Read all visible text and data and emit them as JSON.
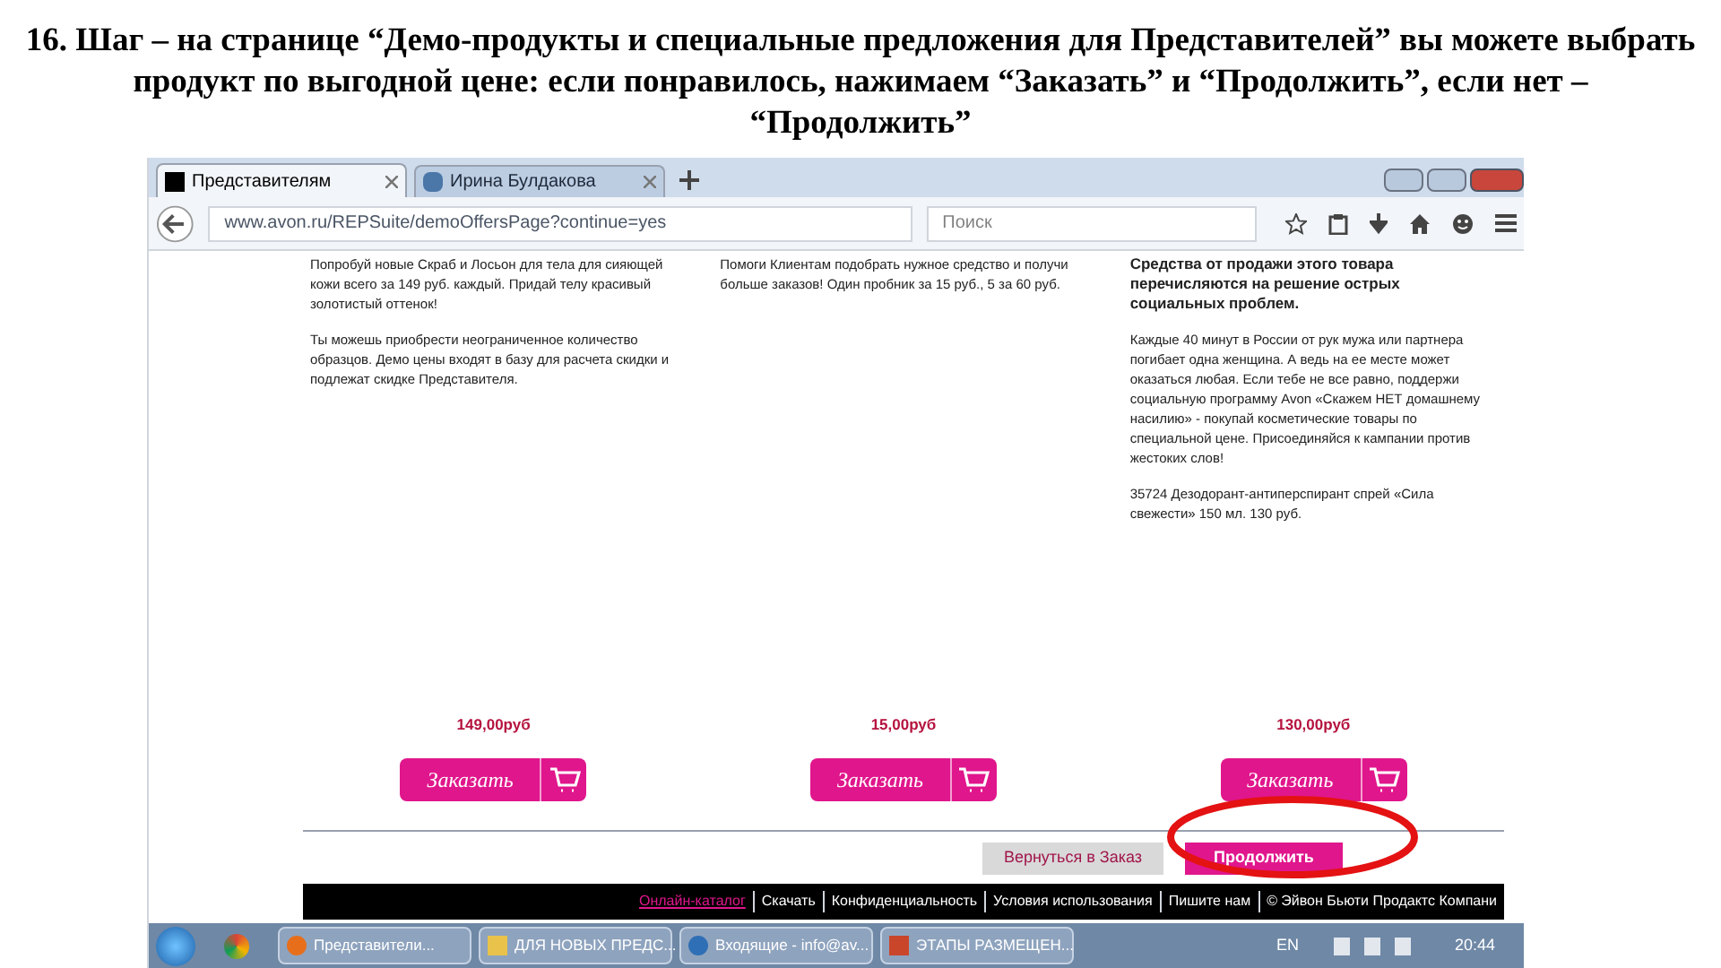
{
  "slide_title": "16. Шаг – на странице “Демо-продукты и специальные предложения для Представителей” вы можете выбрать продукт по выгодной цене: если понравилось, нажимаем “Заказать” и “Продолжить”, если нет – “Продолжить”",
  "browser": {
    "tabs": [
      {
        "label": "Представителям",
        "selected": true
      },
      {
        "label": "Ирина Булдакова",
        "selected": false
      }
    ],
    "url": "www.avon.ru/REPSuite/demoOffersPage?continue=yes",
    "search": {
      "placeholder": "Поиск"
    }
  },
  "products": [
    {
      "paragraphs": [
        {
          "text": "Попробуй новые Скраб и Лосьон для тела для сияющей кожи всего за 149 руб. каждый. Придай телу красивый золотистый оттенок!",
          "bold": false
        },
        {
          "text": "Ты можешь приобрести неограниченное количество образцов. Демо цены входят в базу для расчета скидки и подлежат скидке Представителя.",
          "bold": false
        }
      ],
      "price": "149,00руб",
      "order_button": "Заказать"
    },
    {
      "paragraphs": [
        {
          "text": "Помоги Клиентам подобрать нужное средство и получи больше заказов! Один пробник за 15 руб., 5 за 60 руб.",
          "bold": false
        }
      ],
      "price": "15,00руб",
      "order_button": "Заказать"
    },
    {
      "paragraphs": [
        {
          "text": "Средства от продажи этого товара перечисляются на решение острых социальных проблем.",
          "bold": true
        },
        {
          "text": "Каждые 40 минут в России от рук мужа или партнера погибает одна женщина. А ведь на ее месте может оказаться любая. Если тебе не все равно, поддержи социальную программу Avon «Скажем НЕТ домашнему насилию» - покупай косметические товары по специальной цене. Присоединяйся к кампании против жестоких слов!",
          "bold": false
        },
        {
          "text": "35724 Дезодорант-антиперспирант спрей «Сила свежести» 150 мл. 130 руб.",
          "bold": false
        }
      ],
      "price": "130,00руб",
      "order_button": "Заказать"
    }
  ],
  "back_button": "Вернуться в Заказ",
  "continue_button": "Продолжить",
  "footer_links": [
    {
      "label": "Онлайн-каталог",
      "kind": "highlight"
    },
    {
      "label": "Скачать",
      "kind": "plain"
    },
    {
      "label": "Конфиденциальность",
      "kind": "plain"
    },
    {
      "label": "Условия использования",
      "kind": "plain"
    },
    {
      "label": "Пишите нам",
      "kind": "plain"
    },
    {
      "label": "© Эйвон Бьюти Продактс Компани",
      "kind": "plain"
    }
  ],
  "taskbar": {
    "tasks": [
      {
        "label": "Представители...",
        "kind": "browser"
      },
      {
        "label": "ДЛЯ НОВЫХ ПРЕДС...",
        "kind": "folder"
      },
      {
        "label": "Входящие - info@av...",
        "kind": "mail"
      },
      {
        "label": "ЭТАПЫ РАЗМЕЩЕН...",
        "kind": "slides"
      }
    ],
    "language": "EN",
    "time": "20:44"
  }
}
